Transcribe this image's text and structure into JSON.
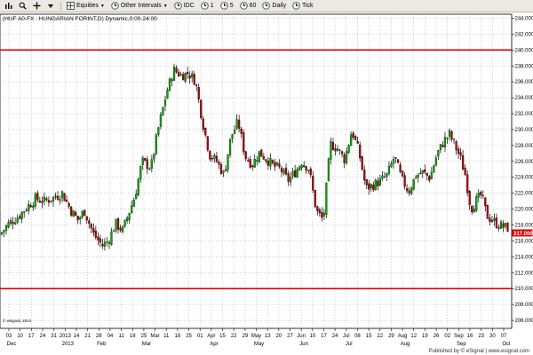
{
  "toolbar": {
    "items": [
      {
        "label": "Equities",
        "icon": "grid-icon",
        "dropdown": true
      },
      {
        "label": "Other Intervals",
        "icon": "clock-icon",
        "dropdown": true
      },
      {
        "label": "IDC",
        "icon": "clock-icon"
      },
      {
        "label": "1"
      },
      {
        "label": "5"
      },
      {
        "label": "60"
      },
      {
        "label": "Daily"
      },
      {
        "label": "Tick"
      }
    ]
  },
  "chart_header": "(HUF A0-FX : HUNGARIAN FORINT,D) Dynamic,0:00-24:00",
  "copyright": "© eSignal, 2013",
  "published_by": "Published by © eSignal | www.esignal.com",
  "colors": {
    "up": "#00aa00",
    "down": "#b00000",
    "hline": "#e00000",
    "grid": "#b0b0b0",
    "last_price_bg": "#e00000"
  },
  "chart_data": {
    "type": "candlestick",
    "title": "(HUF A0-FX : HUNGARIAN FORINT,D) Dynamic,0:00-24:00",
    "x_tick_labels": [
      "03",
      "10",
      "17",
      "24",
      "31",
      "2013",
      "14",
      "21",
      "28",
      "04",
      "11",
      "18",
      "25",
      "Mar",
      "11",
      "18",
      "25",
      "01",
      "Apr",
      "15",
      "22",
      "29",
      "May",
      "13",
      "20",
      "27",
      "Jun",
      "10",
      "17",
      "24",
      "Jul",
      "08",
      "15",
      "22",
      "29",
      "Aug",
      "12",
      "19",
      "26",
      "02",
      "Sep",
      "16",
      "23",
      "30",
      "07"
    ],
    "month_labels": [
      "Dec",
      "2013",
      "Feb",
      "Mar",
      "Apr",
      "May",
      "Jun",
      "Jul",
      "Aug",
      "Sep",
      "Oct"
    ],
    "y_tick_labels": [
      "244.000",
      "242.000",
      "240.000",
      "238.000",
      "236.000",
      "234.000",
      "232.000",
      "230.000",
      "228.000",
      "226.000",
      "224.000",
      "222.000",
      "220.000",
      "218.000",
      "216.000",
      "214.000",
      "212.000",
      "210.000",
      "208.000",
      "206.000"
    ],
    "ylim": [
      205,
      244.5
    ],
    "horizontal_lines": [
      240,
      210
    ],
    "last_price": "217.000",
    "anchors": [
      [
        0,
        216.8
      ],
      [
        10,
        218.2
      ],
      [
        20,
        219.0
      ],
      [
        30,
        220.2
      ],
      [
        40,
        221.3
      ],
      [
        50,
        221.0
      ],
      [
        60,
        221.4
      ],
      [
        70,
        222.0
      ],
      [
        80,
        219.8
      ],
      [
        88,
        218.6
      ],
      [
        95,
        219.8
      ],
      [
        105,
        216.9
      ],
      [
        115,
        215.4
      ],
      [
        122,
        216.0
      ],
      [
        130,
        218.2
      ],
      [
        138,
        217.3
      ],
      [
        145,
        219.5
      ],
      [
        152,
        221.7
      ],
      [
        160,
        226.0
      ],
      [
        170,
        225.2
      ],
      [
        178,
        230.0
      ],
      [
        188,
        234.9
      ],
      [
        196,
        237.5
      ],
      [
        204,
        236.8
      ],
      [
        212,
        237.1
      ],
      [
        220,
        236.1
      ],
      [
        228,
        231.0
      ],
      [
        236,
        226.8
      ],
      [
        244,
        226.0
      ],
      [
        252,
        224.3
      ],
      [
        260,
        229.1
      ],
      [
        268,
        231.0
      ],
      [
        276,
        226.6
      ],
      [
        284,
        225.6
      ],
      [
        292,
        227.1
      ],
      [
        300,
        226.3
      ],
      [
        308,
        225.4
      ],
      [
        316,
        225.0
      ],
      [
        324,
        223.6
      ],
      [
        332,
        224.6
      ],
      [
        340,
        226.0
      ],
      [
        348,
        225.0
      ],
      [
        356,
        219.8
      ],
      [
        364,
        218.6
      ],
      [
        372,
        228.2
      ],
      [
        380,
        227.6
      ],
      [
        388,
        226.2
      ],
      [
        396,
        229.9
      ],
      [
        404,
        227.2
      ],
      [
        412,
        222.6
      ],
      [
        420,
        223.0
      ],
      [
        428,
        223.5
      ],
      [
        436,
        224.3
      ],
      [
        444,
        226.6
      ],
      [
        452,
        223.8
      ],
      [
        460,
        222.2
      ],
      [
        468,
        224.2
      ],
      [
        476,
        224.6
      ],
      [
        484,
        223.9
      ],
      [
        492,
        226.9
      ],
      [
        500,
        228.6
      ],
      [
        506,
        229.4
      ],
      [
        512,
        228.0
      ],
      [
        518,
        226.5
      ],
      [
        524,
        224.2
      ],
      [
        530,
        220.0
      ],
      [
        536,
        221.0
      ],
      [
        542,
        221.8
      ],
      [
        548,
        219.2
      ],
      [
        554,
        218.6
      ],
      [
        560,
        218.1
      ],
      [
        566,
        217.8
      ],
      [
        572,
        217.6
      ]
    ]
  }
}
